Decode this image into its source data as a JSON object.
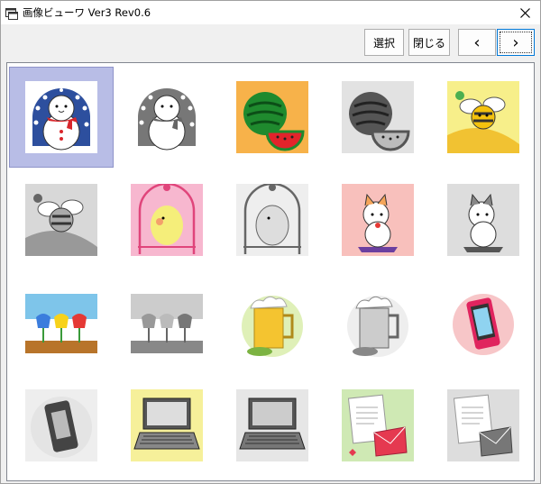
{
  "window": {
    "title": "画像ビューワ Ver3 Rev0.6",
    "icon": "app-window-icon",
    "close_icon": "close-icon"
  },
  "toolbar": {
    "select_label": "選択",
    "close_label": "閉じる",
    "prev_label": "‹",
    "next_label": "›"
  },
  "thumbnails": [
    {
      "name": "snowman-color",
      "selected": true
    },
    {
      "name": "snowman-gray",
      "selected": false
    },
    {
      "name": "watermelon-color",
      "selected": false
    },
    {
      "name": "watermelon-gray",
      "selected": false
    },
    {
      "name": "bee-color",
      "selected": false
    },
    {
      "name": "bee-gray",
      "selected": false
    },
    {
      "name": "parakeet-color",
      "selected": false
    },
    {
      "name": "parakeet-gray",
      "selected": false
    },
    {
      "name": "cat-color",
      "selected": false
    },
    {
      "name": "cat-gray",
      "selected": false
    },
    {
      "name": "tulips-color",
      "selected": false
    },
    {
      "name": "tulips-gray",
      "selected": false
    },
    {
      "name": "beer-color",
      "selected": false
    },
    {
      "name": "beer-gray",
      "selected": false
    },
    {
      "name": "smartphone-color",
      "selected": false
    },
    {
      "name": "smartphone-gray",
      "selected": false
    },
    {
      "name": "laptop-color",
      "selected": false
    },
    {
      "name": "laptop-gray",
      "selected": false
    },
    {
      "name": "letter-color",
      "selected": false
    },
    {
      "name": "letter-gray",
      "selected": false
    }
  ],
  "colors": {
    "selection": "#b8bde6",
    "focus_border": "#0078d7"
  }
}
